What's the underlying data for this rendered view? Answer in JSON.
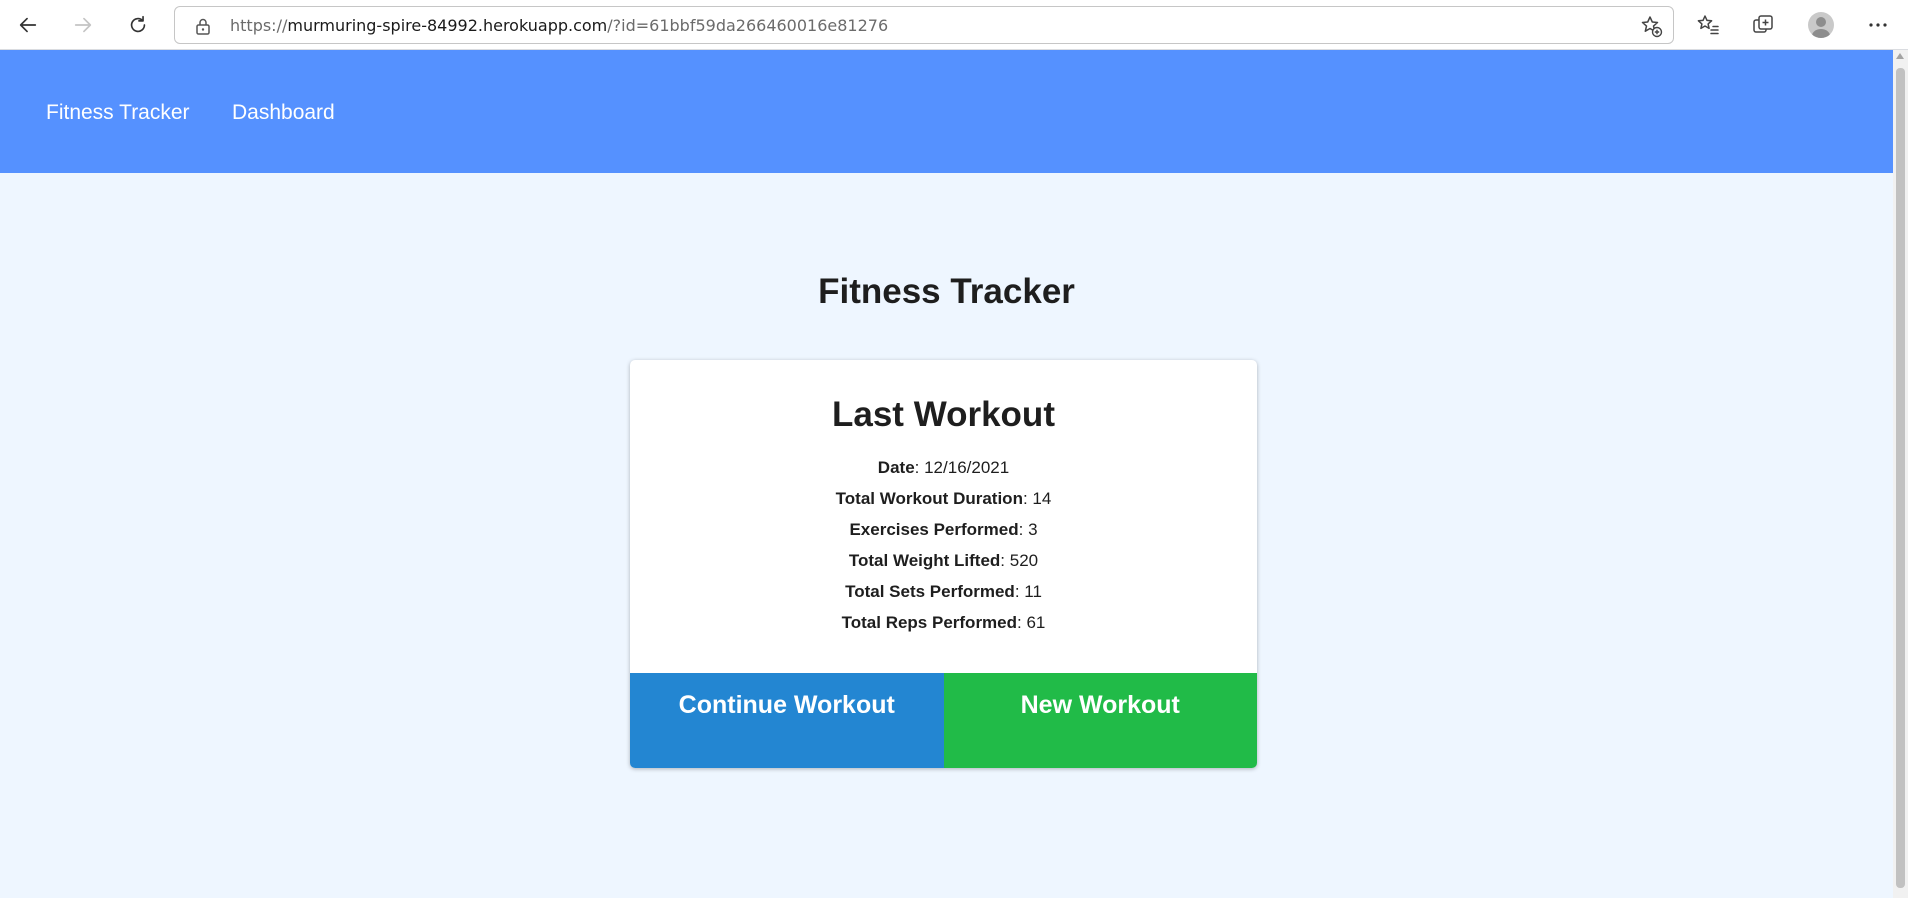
{
  "browser": {
    "url_prefix": "https://",
    "url_host": "murmuring-spire-84992.herokuapp.com",
    "url_path": "/?id=61bbf59da266460016e81276"
  },
  "nav": {
    "brand": "Fitness Tracker",
    "dashboard": "Dashboard"
  },
  "main": {
    "title": "Fitness Tracker",
    "card": {
      "title": "Last Workout",
      "stats": [
        {
          "label": "Date",
          "value": ": 12/16/2021"
        },
        {
          "label": "Total Workout Duration",
          "value": ": 14"
        },
        {
          "label": "Exercises Performed",
          "value": ": 3"
        },
        {
          "label": "Total Weight Lifted",
          "value": ": 520"
        },
        {
          "label": "Total Sets Performed",
          "value": ": 11"
        },
        {
          "label": "Total Reps Performed",
          "value": ": 61"
        }
      ],
      "continue_label": "Continue Workout",
      "new_label": "New Workout"
    }
  },
  "colors": {
    "header": "#5591ff",
    "background": "#eef6ff",
    "continue_button": "#2386d2",
    "new_button": "#21bb48"
  },
  "icons": [
    "back-arrow-icon",
    "forward-arrow-icon",
    "refresh-icon",
    "lock-icon",
    "add-favorite-icon",
    "favorites-icon",
    "collections-icon",
    "profile-icon",
    "more-icon"
  ]
}
